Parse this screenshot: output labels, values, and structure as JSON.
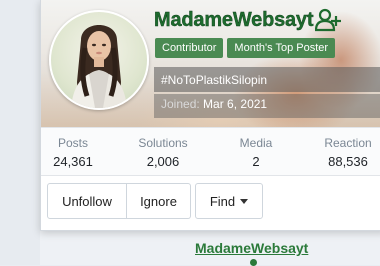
{
  "profile": {
    "username": "MadameWebsayt",
    "badges": [
      "Contributor",
      "Month's Top Poster"
    ],
    "signature": "#NoToPlastikSilopin",
    "joined_label": "Joined:",
    "joined_date": "Mar 6, 2021"
  },
  "stats": [
    {
      "label": "Posts",
      "value": "24,361"
    },
    {
      "label": "Solutions",
      "value": "2,006"
    },
    {
      "label": "Media",
      "value": "2"
    },
    {
      "label": "Reaction",
      "value": "88,536"
    }
  ],
  "actions": {
    "unfollow": "Unfollow",
    "ignore": "Ignore",
    "find": "Find"
  },
  "underlay": {
    "username": "MadameWebsayt"
  },
  "colors": {
    "username": "#1e6b2e",
    "badge_bg": "#4a8a52",
    "link": "#2b7a3a"
  },
  "icons": {
    "follow": "person-add-icon",
    "find_menu": "caret-down-icon"
  }
}
